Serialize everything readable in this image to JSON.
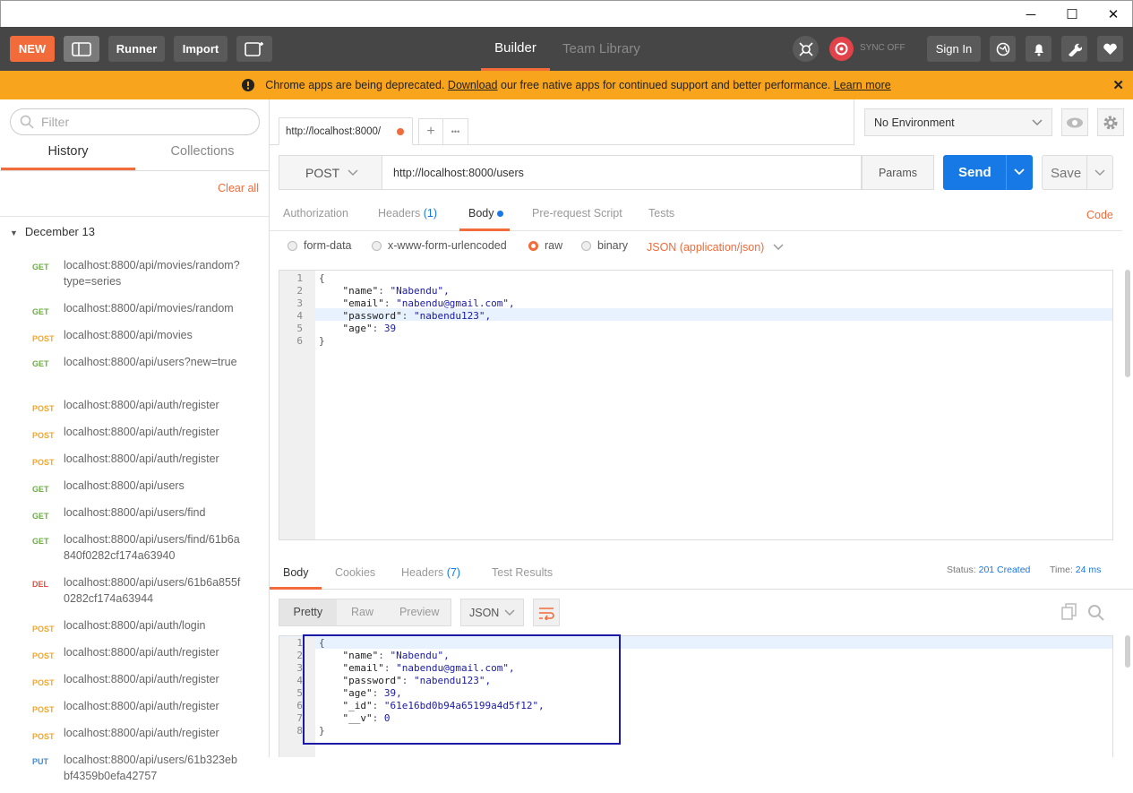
{
  "window": {
    "min": "─",
    "max": "☐",
    "close": "✕"
  },
  "topbar": {
    "new_label": "NEW",
    "runner_label": "Runner",
    "import_label": "Import",
    "builder_label": "Builder",
    "team_library_label": "Team Library",
    "sync_label": "SYNC OFF",
    "signin_label": "Sign In"
  },
  "banner": {
    "text_before": "Chrome apps are being deprecated.",
    "download_link": "Download",
    "text_after": "our free native apps for continued support and better performance.",
    "learn_more_link": "Learn more",
    "close": "✕"
  },
  "sidebar": {
    "filter_placeholder": "Filter",
    "tabs": [
      {
        "label": "History"
      },
      {
        "label": "Collections"
      }
    ],
    "clear_all": "Clear all",
    "group_label": "December 13",
    "items": [
      {
        "method": "GET",
        "url": "localhost:8800/api/movies/random?type=series"
      },
      {
        "method": "GET",
        "url": "localhost:8800/api/movies/random"
      },
      {
        "method": "POST",
        "url": "localhost:8800/api/movies"
      },
      {
        "method": "GET",
        "url": "localhost:8800/api/users?new=true"
      },
      {
        "method": "POST",
        "url": "localhost:8800/api/auth/register"
      },
      {
        "method": "POST",
        "url": "localhost:8800/api/auth/register"
      },
      {
        "method": "POST",
        "url": "localhost:8800/api/auth/register"
      },
      {
        "method": "GET",
        "url": "localhost:8800/api/users"
      },
      {
        "method": "GET",
        "url": "localhost:8800/api/users/find"
      },
      {
        "method": "GET",
        "url": "localhost:8800/api/users/find/61b6a840f0282cf174a63940"
      },
      {
        "method": "DEL",
        "url": "localhost:8800/api/users/61b6a855f0282cf174a63944"
      },
      {
        "method": "POST",
        "url": "localhost:8800/api/auth/login"
      },
      {
        "method": "POST",
        "url": "localhost:8800/api/auth/register"
      },
      {
        "method": "POST",
        "url": "localhost:8800/api/auth/register"
      },
      {
        "method": "POST",
        "url": "localhost:8800/api/auth/register"
      },
      {
        "method": "POST",
        "url": "localhost:8800/api/auth/register"
      },
      {
        "method": "PUT",
        "url": "localhost:8800/api/users/61b323ebbf4359b0efa42757"
      }
    ]
  },
  "request_tab": {
    "label": "http://localhost:8000/",
    "plus": "+",
    "more": "•••"
  },
  "environment": {
    "selected": "No Environment"
  },
  "request": {
    "method": "POST",
    "url": "http://localhost:8000/users",
    "params_label": "Params",
    "send_label": "Send",
    "save_label": "Save"
  },
  "req_tabs": {
    "authorization": "Authorization",
    "headers": "Headers",
    "headers_count": "(1)",
    "body": "Body",
    "prerequest": "Pre-request Script",
    "tests": "Tests",
    "code": "Code"
  },
  "body_types": {
    "form_data": "form-data",
    "urlencoded": "x-www-form-urlencoded",
    "raw": "raw",
    "binary": "binary",
    "content_type": "JSON (application/json)"
  },
  "request_body": [
    {
      "n": "1",
      "text": "{"
    },
    {
      "n": "2",
      "k": "\"name\"",
      "v": "\"Nabendu\","
    },
    {
      "n": "3",
      "k": "\"email\"",
      "v": "\"nabendu@gmail.com\","
    },
    {
      "n": "4",
      "k": "\"password\"",
      "v": "\"nabendu123\","
    },
    {
      "n": "5",
      "k": "\"age\"",
      "v": "39"
    },
    {
      "n": "6",
      "text": "}"
    }
  ],
  "response": {
    "tabs": {
      "body": "Body",
      "cookies": "Cookies",
      "headers": "Headers",
      "headers_count": "(7)",
      "tests": "Test Results"
    },
    "status_label": "Status:",
    "status_value": "201 Created",
    "time_label": "Time:",
    "time_value": "24 ms",
    "view_modes": [
      "Pretty",
      "Raw",
      "Preview"
    ],
    "format": "JSON",
    "lines": [
      {
        "n": "1",
        "text": "{"
      },
      {
        "n": "2",
        "k": "\"name\"",
        "v": "\"Nabendu\","
      },
      {
        "n": "3",
        "k": "\"email\"",
        "v": "\"nabendu@gmail.com\","
      },
      {
        "n": "4",
        "k": "\"password\"",
        "v": "\"nabendu123\","
      },
      {
        "n": "5",
        "k": "\"age\"",
        "v": "39,"
      },
      {
        "n": "6",
        "k": "\"_id\"",
        "v": "\"61e16bd0b94a65199a4d5f12\","
      },
      {
        "n": "7",
        "k": "\"__v\"",
        "v": "0"
      },
      {
        "n": "8",
        "text": "}"
      }
    ]
  },
  "colors": {
    "accent": "#f26b3a",
    "send": "#1679e6",
    "banner": "#f8a51d",
    "highlight_box": "#1a1aa6"
  }
}
